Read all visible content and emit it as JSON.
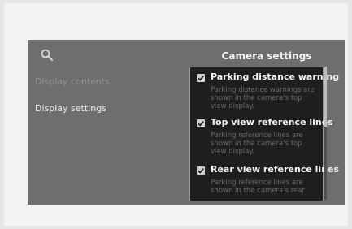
{
  "menu": {
    "items": [
      {
        "label": "Display contents"
      },
      {
        "label": "Display settings"
      }
    ]
  },
  "camera_settings": {
    "title": "Camera settings",
    "options": [
      {
        "label": "Parking distance warning",
        "description": "Parking distance warnings are shown in the camera's top view display.",
        "checked": true
      },
      {
        "label": "Top view reference lines",
        "description": "Parking reference lines are shown in the camera's top view display.",
        "checked": true
      },
      {
        "label": "Rear view reference lines",
        "description": "Parking reference lines are shown in the camera's rear",
        "checked": true
      }
    ]
  },
  "icons": {
    "search": "search-icon",
    "checkbox": "checkbox-checked-icon"
  },
  "colors": {
    "screen_bg": "#6e6e6e",
    "panel_bg": "#1e1e1e",
    "text_active": "#f1f1f1",
    "text_dim": "#939393"
  }
}
